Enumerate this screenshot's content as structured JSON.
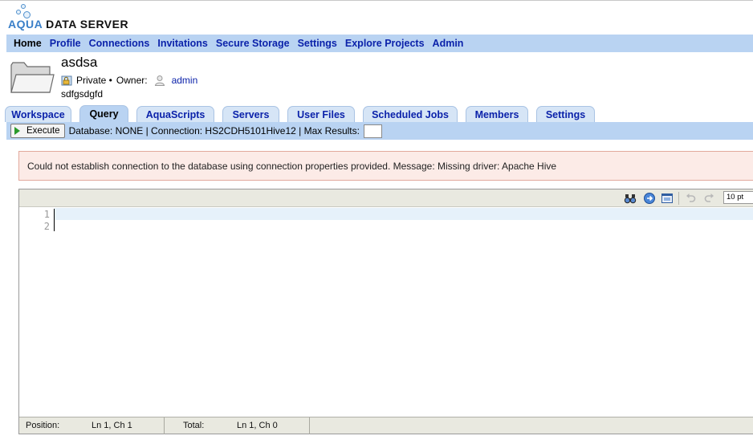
{
  "logo": {
    "brand_left": "AQUA",
    "brand_right": "DATA SERVER"
  },
  "nav": {
    "items": [
      "Home",
      "Profile",
      "Connections",
      "Invitations",
      "Secure Storage",
      "Settings",
      "Explore Projects",
      "Admin"
    ],
    "active": "Home"
  },
  "project": {
    "title": "asdsa",
    "visibility": "Private •",
    "owner_label": "Owner:",
    "owner": "admin",
    "description": "sdfgsdgfd"
  },
  "tabs": {
    "items": [
      "Workspace",
      "Query",
      "AquaScripts",
      "Servers",
      "User Files",
      "Scheduled Jobs",
      "Members",
      "Settings"
    ],
    "active": "Query"
  },
  "query_bar": {
    "execute_label": "Execute",
    "info": "Database: NONE | Connection: HS2CDH5101Hive12 | Max Results:",
    "max_results_value": ""
  },
  "error": {
    "message": "Could not establish connection to the database using connection properties provided. Message: Missing driver: Apache Hive"
  },
  "editor": {
    "font_size": "10 pt",
    "line_numbers": [
      "1",
      "2"
    ],
    "status": {
      "position_label": "Position:",
      "position_value": "Ln 1, Ch 1",
      "total_label": "Total:",
      "total_value": "Ln 1, Ch 0"
    },
    "toolbar_icons": [
      "find-icon",
      "goto-icon",
      "fullscreen-icon",
      "undo-icon",
      "redo-icon"
    ]
  },
  "colors": {
    "nav_bar": "#b9d3f2",
    "link": "#0b22aa",
    "error_bg": "#fcebe7",
    "error_border": "#e2a99c"
  }
}
